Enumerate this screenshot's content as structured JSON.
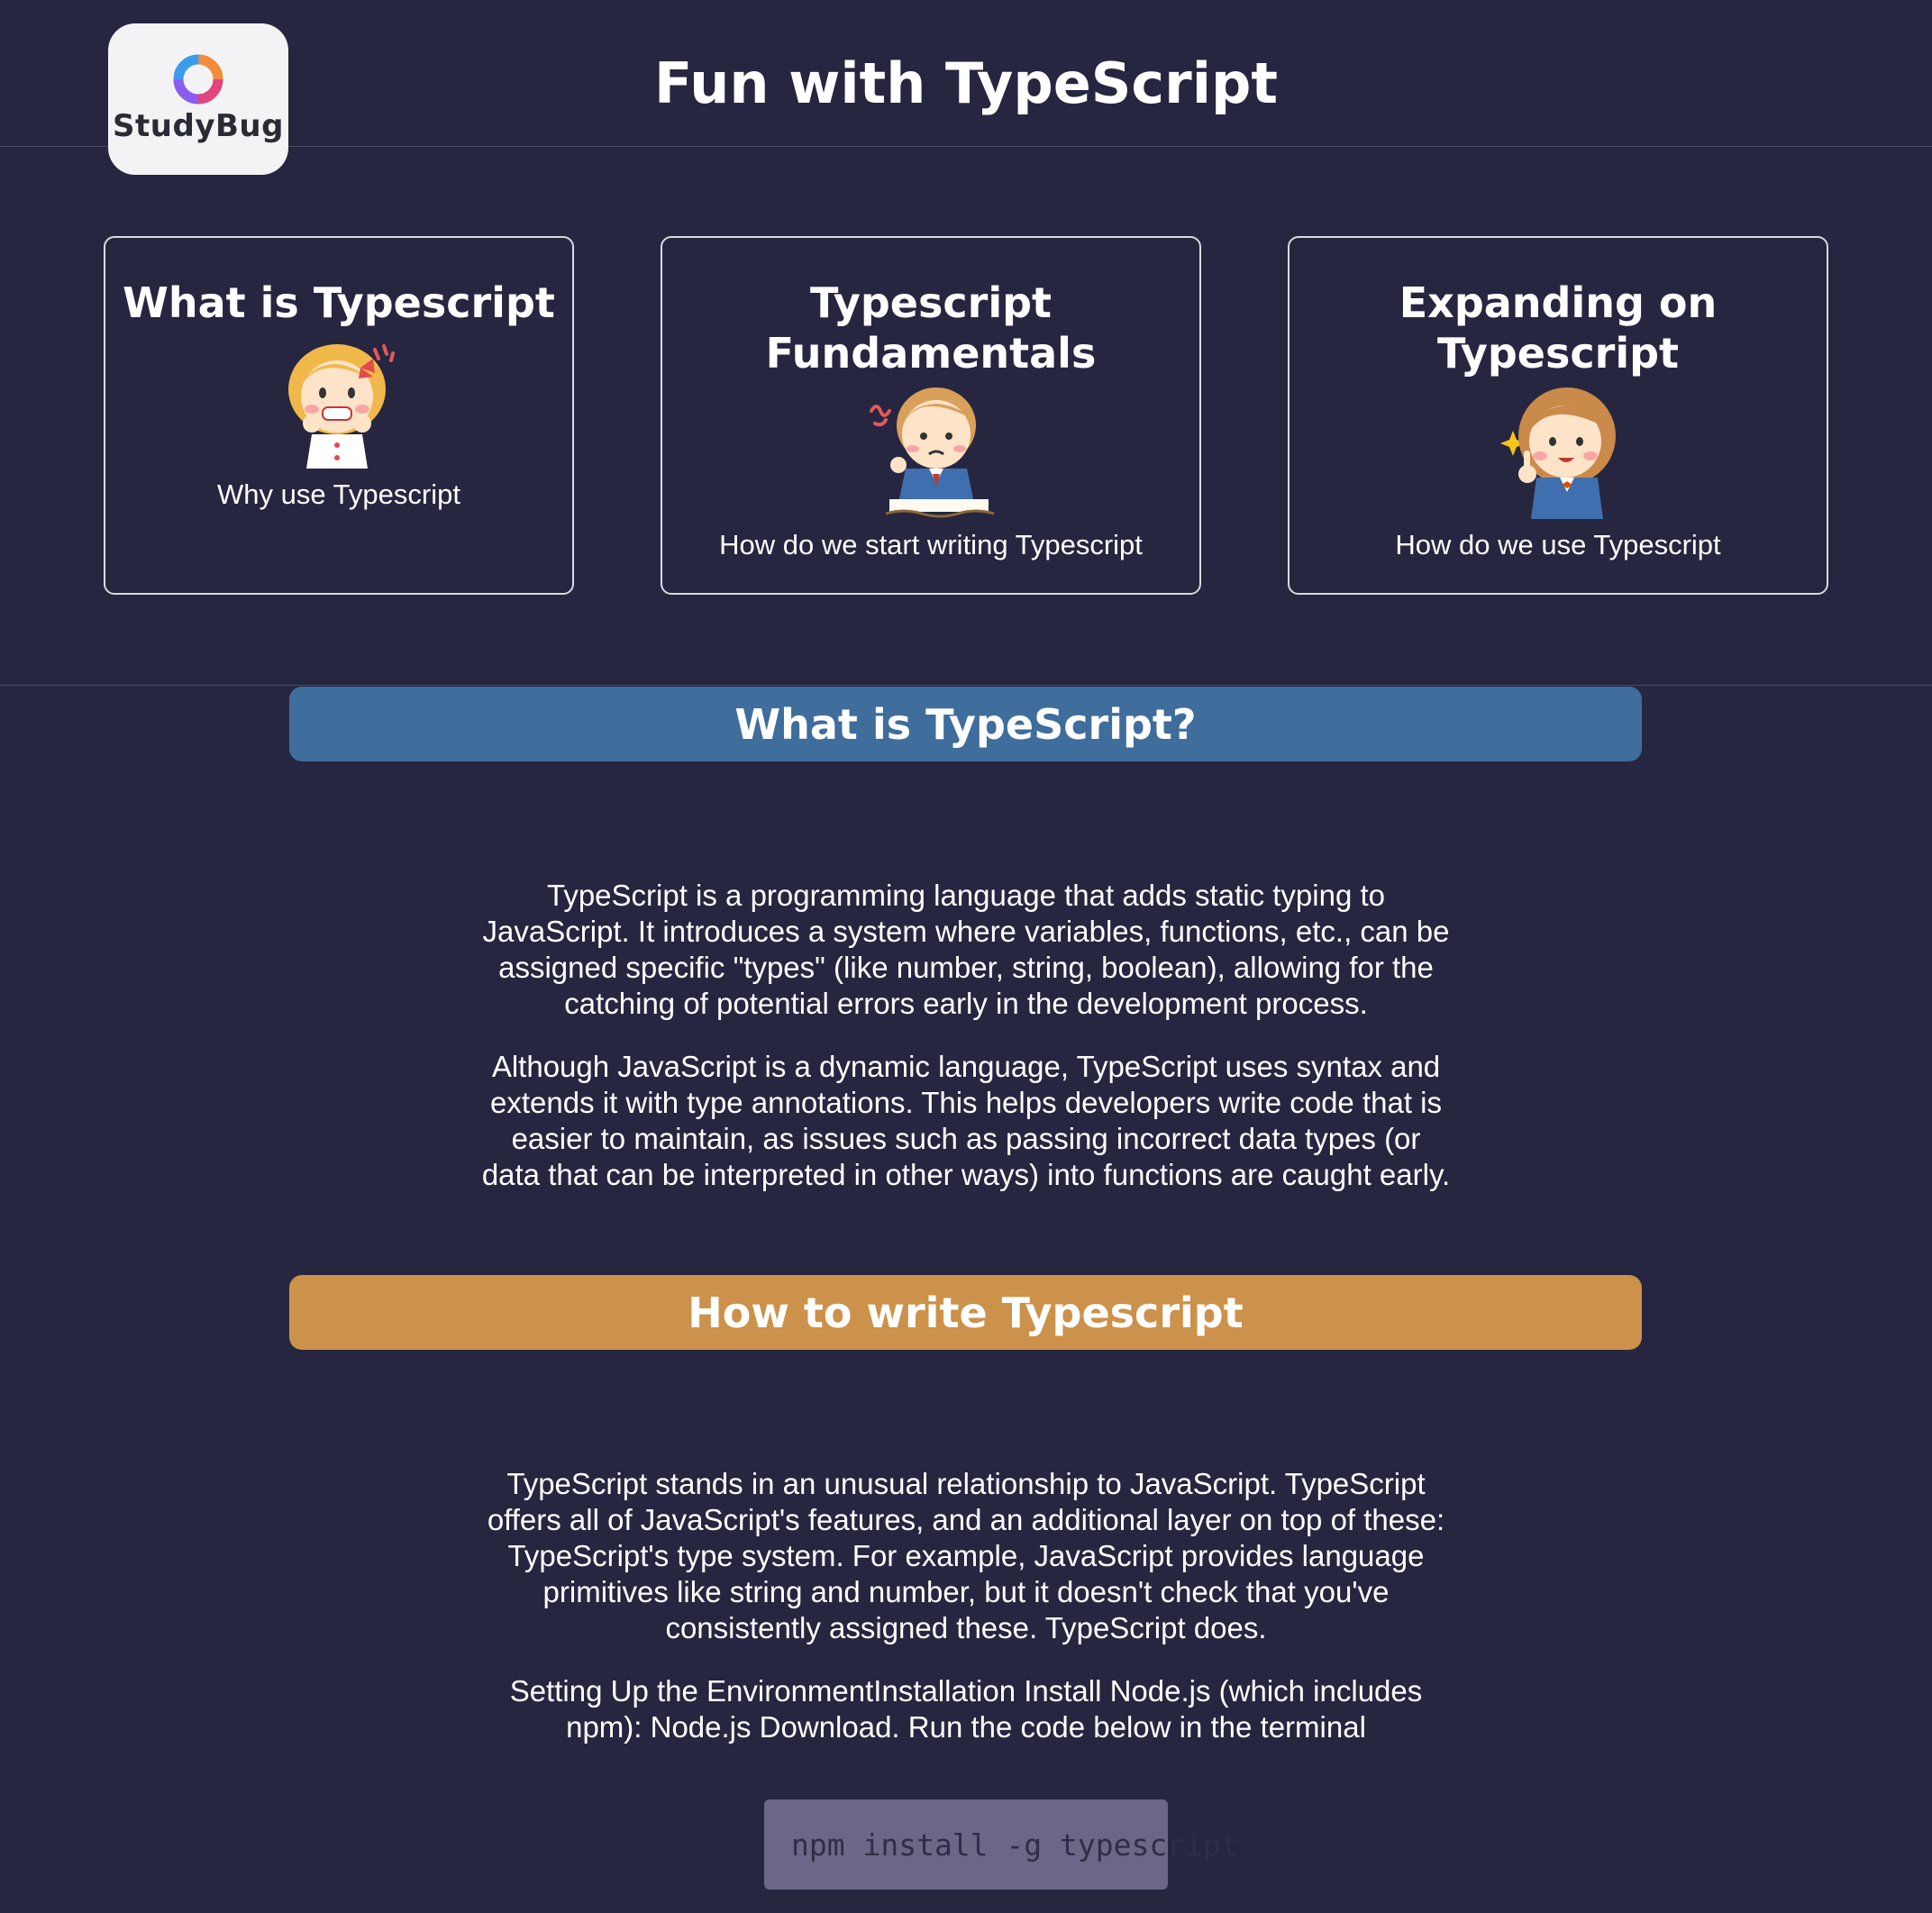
{
  "header": {
    "logo_text": "StudyBug",
    "title": "Fun with TypeScript"
  },
  "cards": [
    {
      "title": "What is Typescript",
      "description": "Why use Typescript"
    },
    {
      "title": "Typescript Fundamentals",
      "description": "How do we start writing Typescript"
    },
    {
      "title": "Expanding on Typescript",
      "description": "How do we use Typescript"
    }
  ],
  "sections": [
    {
      "heading": "What is TypeScript?",
      "color": "#3f6d9c",
      "paragraphs": [
        "TypeScript is a programming language that adds static typing to JavaScript. It introduces a system where variables, functions, etc., can be assigned specific \"types\" (like number, string, boolean), allowing for the catching of potential errors early in the development process.",
        "Although JavaScript is a dynamic language, TypeScript uses syntax and extends it with type annotations. This helps developers write code that is easier to maintain, as issues such as passing incorrect data types (or data that can be interpreted in other ways) into functions are caught early."
      ]
    },
    {
      "heading": "How to write Typescript",
      "color": "#cc914a",
      "paragraphs": [
        "TypeScript stands in an unusual relationship to JavaScript. TypeScript offers all of JavaScript's features, and an additional layer on top of these: TypeScript's type system. For example, JavaScript provides language primitives like string and number, but it doesn't check that you've consistently assigned these. TypeScript does.",
        "Setting Up the EnvironmentInstallation Install Node.js (which includes npm): Node.js Download. Run the code below in the terminal"
      ],
      "code": "npm install -g typescript"
    }
  ],
  "colors": {
    "background": "#272640",
    "accent_blue": "#3f6d9c",
    "accent_orange": "#cc914a",
    "code_bg": "#6a6787"
  },
  "icons": [
    "studybug-logo-icon",
    "girl-excited-illustration",
    "boy-writing-illustration",
    "girl-idea-illustration"
  ]
}
